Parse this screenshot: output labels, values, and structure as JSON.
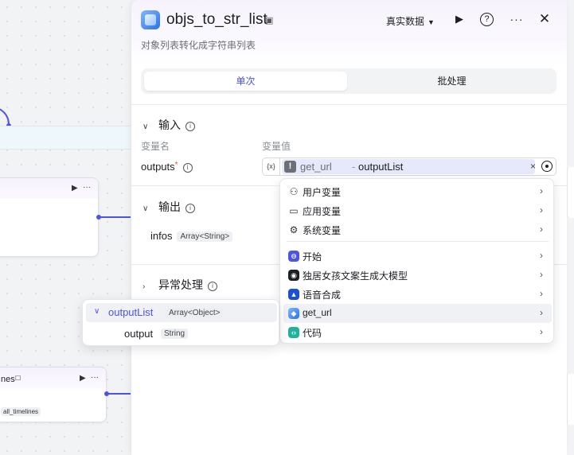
{
  "canvas": {
    "node_fragment_title": "nes",
    "node_fragment_tag": "all_timelines"
  },
  "panel": {
    "title": "objs_to_str_list",
    "subtitle": "对象列表转化成字符串列表",
    "data_mode": "真实数据",
    "tabs": [
      {
        "label": "单次",
        "active": true
      },
      {
        "label": "批处理",
        "active": false
      }
    ]
  },
  "input_section": {
    "title": "输入",
    "col_var_name": "变量名",
    "col_var_value": "变量值",
    "field_name": "outputs",
    "required_mark": "*",
    "ref_icon": "{x}",
    "selected_node": "get_url",
    "selected_separator": "-",
    "selected_var": "outputList"
  },
  "output_section": {
    "title": "输出",
    "var_name": "infos",
    "var_type": "Array<String>"
  },
  "error_section": {
    "title": "异常处理"
  },
  "dropdown": {
    "groups": [
      {
        "label": "用户变量",
        "icon": "user-icon"
      },
      {
        "label": "应用变量",
        "icon": "folder-icon"
      },
      {
        "label": "系统变量",
        "icon": "gear-icon"
      }
    ],
    "nodes": [
      {
        "label": "开始",
        "icon": "start-node-icon",
        "color": "#4d53e8"
      },
      {
        "label": "独居女孩文案生成大模型",
        "icon": "llm-node-icon",
        "color": "#1c1f23"
      },
      {
        "label": "语音合成",
        "icon": "tts-node-icon",
        "color": "#1b4fd8"
      },
      {
        "label": "get_url",
        "icon": "plugin-node-icon",
        "color": "#2a72e8",
        "hover": true
      },
      {
        "label": "代码",
        "icon": "code-node-icon",
        "color": "#1fb39c"
      }
    ]
  },
  "subpopup": {
    "parent_name": "outputList",
    "parent_type": "Array<Object>",
    "child_name": "output",
    "child_type": "String"
  },
  "colors": {
    "accent": "#4d53e8",
    "required": "#f0463c"
  }
}
